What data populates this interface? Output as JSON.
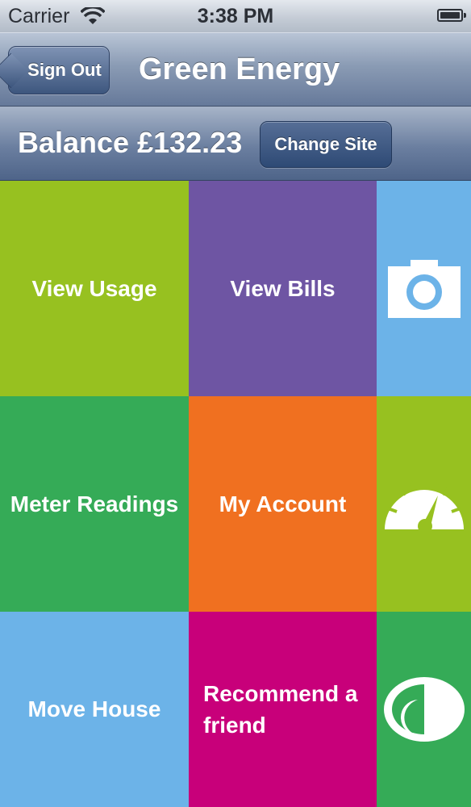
{
  "status_bar": {
    "carrier": "Carrier",
    "time": "3:38 PM",
    "icons": [
      "wifi-icon",
      "battery-icon"
    ]
  },
  "nav": {
    "back_label": "Sign Out",
    "title": "Green Energy"
  },
  "balance": {
    "text": "Balance £132.23",
    "change_site_label": "Change Site"
  },
  "tiles": [
    {
      "label": "View Usage",
      "color": "#97c120"
    },
    {
      "label": "View Bills",
      "color": "#6e55a3"
    },
    {
      "icon": "camera-icon",
      "color": "#6cb3e8"
    },
    {
      "label": "Meter Readings",
      "color": "#35ab57"
    },
    {
      "label": "My Account",
      "color": "#f07020"
    },
    {
      "icon": "speedometer-icon",
      "color": "#97c120"
    },
    {
      "label": "Move House",
      "color": "#6cb3e8"
    },
    {
      "label": "Recommend a friend",
      "color": "#c8007a"
    },
    {
      "icon": "logo-icon",
      "color": "#35ab57"
    }
  ]
}
